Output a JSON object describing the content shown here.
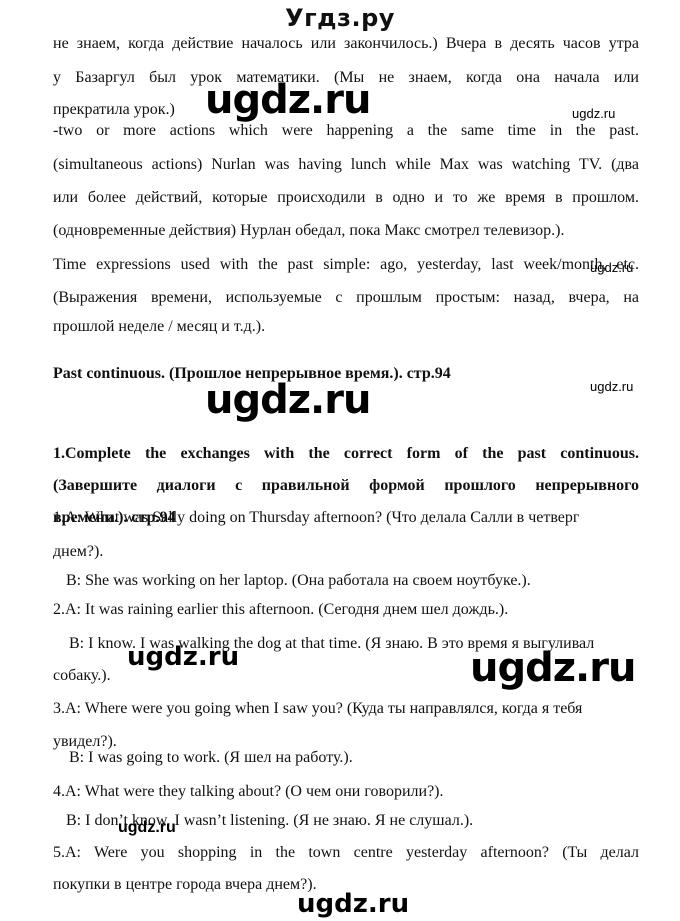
{
  "header": {
    "site_title": "Угдз.ру"
  },
  "watermarks": {
    "big": "ugdz.ru",
    "small": "ugdz.ru"
  },
  "lines": [
    "не знаем, когда действие началось или закончилось.) Вчера в десять часов утра",
    "у Базаргул был урок математики. (Мы не знаем, когда она начала или",
    "прекратила урок.)",
    "-two or more actions which were happening a the same time in the past.",
    "(simultaneous actions) Nurlan was having lunch while Max was watching TV. (два",
    "или более действий, которые происходили в одно и то же время в прошлом.",
    "(одновременные действия) Нурлан обедал, пока Макс смотрел телевизор.).",
    "Time expressions used with the past simple: ago, yesterday, last week/month, etc.",
    "(Выражения времени, используемые с прошлым простым: назад, вчера, на",
    "прошлой неделе / месяц и т.д.).",
    "Past continuous. (Прошлое непрерывное время.). стр.94",
    "1.Complete the exchanges with the correct form of the past continuous.",
    "(Завершите диалоги с правильной формой прошлого непрерывного",
    "времени.). стр.94",
    "1.A: What was Sally doing on Thursday afternoon? (Что делала Салли в четверг",
    "днем?).",
    "B: She was working on her laptop. (Она работала на своем ноутбуке.).",
    "2.A: It was raining earlier this afternoon. (Сегодня днем шел дождь.).",
    "B: I know. I was walking the dog at that time. (Я знаю. В это время я выгуливал",
    "собаку.).",
    "3.A: Where were you going when I saw you? (Куда ты направлялся, когда я тебя",
    "увидел?).",
    "B: I was going to work. (Я шел на работу.).",
    "4.A: What were they talking about? (О чем они говорили?).",
    "B: I don’t know. I wasn’t listening. (Я не знаю. Я не слушал.).",
    "5.A: Were you shopping in the town centre yesterday afternoon? (Ты делал",
    "покупки в центре города вчера днем?)."
  ]
}
